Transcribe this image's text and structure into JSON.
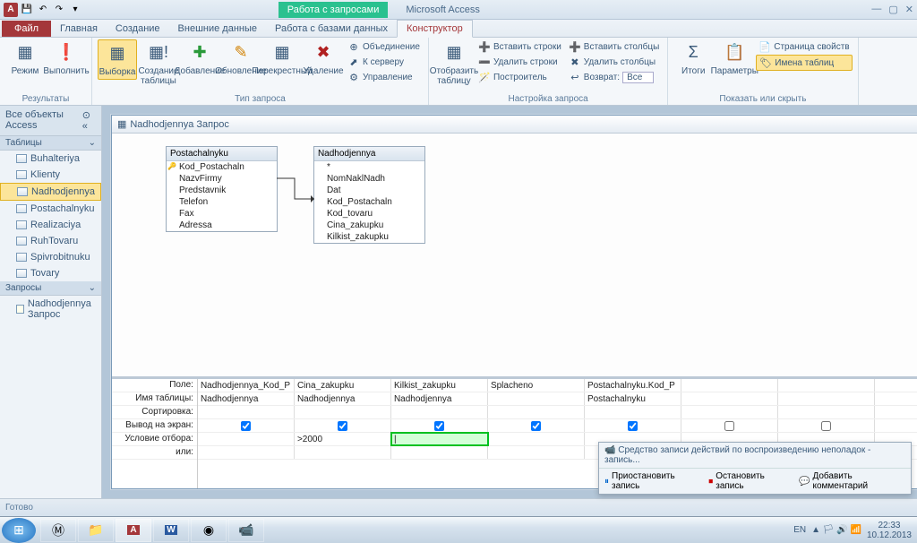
{
  "qat": {
    "save": "💾",
    "undo": "↶",
    "redo": "↷"
  },
  "ctx_tab": "Работа с запросами",
  "app_name": "Microsoft Access",
  "file_tab": "Файл",
  "tabs": [
    "Главная",
    "Создание",
    "Внешние данные",
    "Работа с базами данных"
  ],
  "active_tab": "Конструктор",
  "ribbon": {
    "g1": {
      "label": "Результаты",
      "btn_view": "Режим",
      "btn_run": "Выполнить"
    },
    "g2": {
      "label": "Тип запроса",
      "btn_select": "Выборка",
      "btn_maketable": "Создание таблицы",
      "btn_append": "Добавление",
      "btn_update": "Обновление",
      "btn_crosstab": "Перекрестный",
      "btn_delete": "Удаление",
      "s_union": "Объединение",
      "s_server": "К серверу",
      "s_manage": "Управление"
    },
    "g3": {
      "label": "Настройка запроса",
      "btn_show": "Отобразить таблицу",
      "s_ins_r": "Вставить строки",
      "s_del_r": "Удалить строки",
      "s_build": "Построитель",
      "s_ins_c": "Вставить столбцы",
      "s_del_c": "Удалить столбцы",
      "s_return": "Возврат:",
      "s_return_v": "Все"
    },
    "g4": {
      "label": "Показать или скрыть",
      "btn_totals": "Итоги",
      "btn_params": "Параметры",
      "s_prop": "Страница свойств",
      "s_names": "Имена таблиц"
    }
  },
  "nav": {
    "header": "Все объекты Access",
    "sec_tables": "Таблицы",
    "tables": [
      "Buhalteriya",
      "Klienty",
      "Nadhodjennya",
      "Postachalnyku",
      "Realizaciya",
      "RuhTovaru",
      "Spivrobitnuku",
      "Tovary"
    ],
    "sec_queries": "Запросы",
    "queries": [
      "Nadhodjennya Запрос"
    ]
  },
  "query": {
    "title": "Nadhodjennya Запрос",
    "t1": {
      "name": "Postachalnyku",
      "fields": [
        "Kod_Postachaln",
        "NazvFirmy",
        "Predstavnik",
        "Telefon",
        "Fax",
        "Adressa"
      ]
    },
    "t2": {
      "name": "Nadhodjennya",
      "fields": [
        "*",
        "NomNaklNadh",
        "Dat",
        "Kod_Postachaln",
        "Kod_tovaru",
        "Cina_zakupku",
        "Kilkist_zakupku"
      ]
    }
  },
  "grid": {
    "rows": [
      "Поле:",
      "Имя таблицы:",
      "Сортировка:",
      "Вывод на экран:",
      "Условие отбора:",
      "или:"
    ],
    "cols": [
      {
        "field": "Nadhodjennya_Kod_P",
        "table": "Nadhodjennya",
        "show": true,
        "criteria": ""
      },
      {
        "field": "Cina_zakupku",
        "table": "Nadhodjennya",
        "show": true,
        "criteria": ">2000"
      },
      {
        "field": "Kilkist_zakupku",
        "table": "Nadhodjennya",
        "show": true,
        "criteria": "",
        "active": true
      },
      {
        "field": "Splacheno",
        "table": "",
        "show": true,
        "criteria": ""
      },
      {
        "field": "Postachalnyku.Kod_P",
        "table": "Postachalnyku",
        "show": true,
        "criteria": ""
      },
      {
        "field": "",
        "table": "",
        "show": false,
        "criteria": ""
      },
      {
        "field": "",
        "table": "",
        "show": false,
        "criteria": ""
      },
      {
        "field": "",
        "table": "",
        "show": false,
        "criteria": ""
      }
    ]
  },
  "notif": {
    "title": "Средство записи действий по воспроизведению неполадок - запись...",
    "pause": "Приостановить запись",
    "stop": "Остановить запись",
    "comment": "Добавить комментарий"
  },
  "status": "Готово",
  "tray": {
    "lang": "EN",
    "time": "22:33",
    "date": "10.12.2013"
  }
}
